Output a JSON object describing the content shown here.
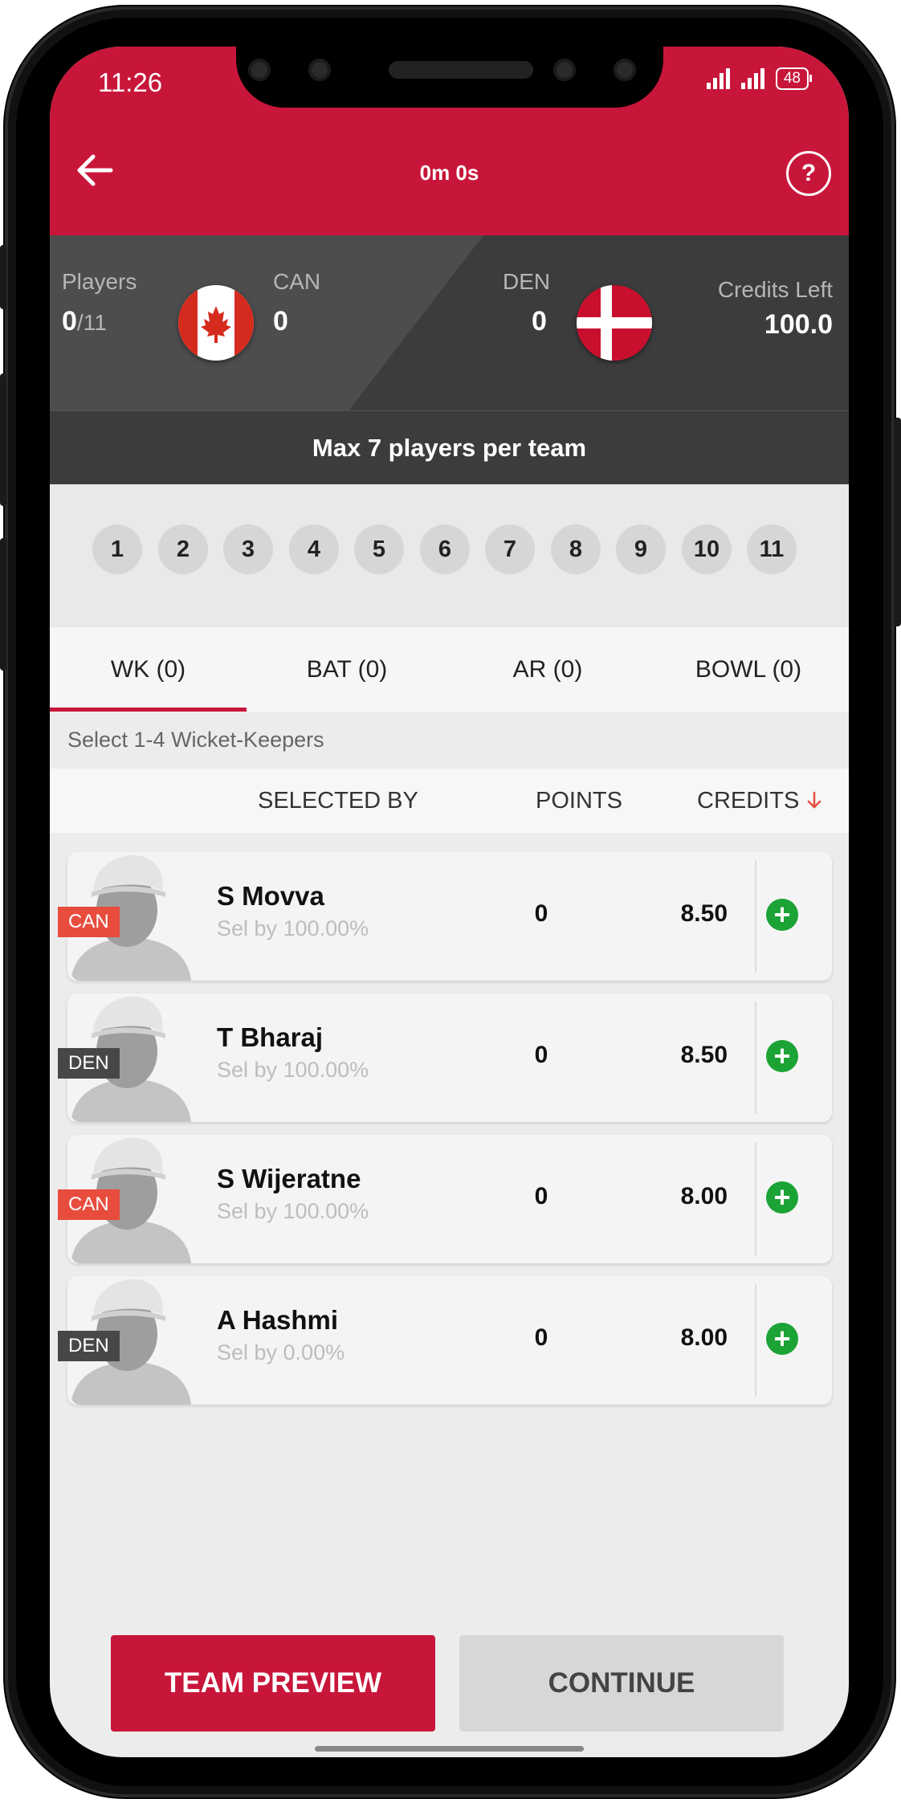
{
  "status_bar": {
    "time": "11:26",
    "battery": "48"
  },
  "header": {
    "timer": "0m 0s",
    "help_glyph": "?"
  },
  "teams": {
    "players_label": "Players",
    "players_selected": "0",
    "players_total": "/11",
    "team1_code": "CAN",
    "team1_count": "0",
    "team2_code": "DEN",
    "team2_count": "0",
    "credits_label": "Credits Left",
    "credits_value": "100.0"
  },
  "max_notice": "Max 7 players per team",
  "slots": [
    "1",
    "2",
    "3",
    "4",
    "5",
    "6",
    "7",
    "8",
    "9",
    "10",
    "11"
  ],
  "tabs": [
    {
      "label": "WK (0)"
    },
    {
      "label": "BAT (0)"
    },
    {
      "label": "AR (0)"
    },
    {
      "label": "BOWL (0)"
    }
  ],
  "hint": "Select 1-4 Wicket-Keepers",
  "columns": {
    "selected_by": "SELECTED BY",
    "points": "POINTS",
    "credits": "CREDITS",
    "sort_icon": "arrow-down-icon"
  },
  "players": [
    {
      "name": "S Movva",
      "selected": "Sel by 100.00%",
      "points": "0",
      "credits": "8.50",
      "team": "CAN"
    },
    {
      "name": "T Bharaj",
      "selected": "Sel by 100.00%",
      "points": "0",
      "credits": "8.50",
      "team": "DEN"
    },
    {
      "name": "S Wijeratne",
      "selected": "Sel by 100.00%",
      "points": "0",
      "credits": "8.00",
      "team": "CAN"
    },
    {
      "name": "A Hashmi",
      "selected": "Sel by 0.00%",
      "points": "0",
      "credits": "8.00",
      "team": "DEN"
    }
  ],
  "buttons": {
    "preview": "TEAM PREVIEW",
    "continue": "CONTINUE"
  },
  "colors": {
    "brand": "#c8163a",
    "add": "#1ba335",
    "can_tag": "#e74c3c",
    "den_tag": "#474747"
  }
}
